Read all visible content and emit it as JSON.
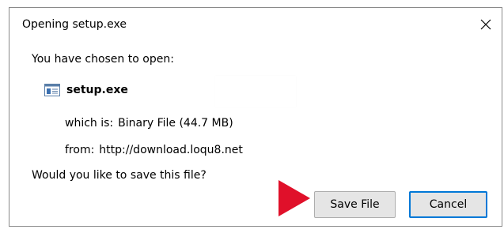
{
  "dialog": {
    "title": "Opening setup.exe",
    "intro": "You have chosen to open:",
    "file_name": "setup.exe",
    "type_label": "which is:",
    "type_value": "Binary File (44.7 MB)",
    "from_label": "from:",
    "from_value": "http://download.loqu8.net",
    "question": "Would you like to save this file?",
    "save_label": "Save File",
    "cancel_label": "Cancel"
  },
  "icons": {
    "close": "close-icon",
    "file": "file-icon",
    "arrow": "arrow-pointer-icon"
  },
  "colors": {
    "focus_border": "#0078d7",
    "button_bg": "#e5e5e5",
    "arrow": "#e0102a"
  }
}
